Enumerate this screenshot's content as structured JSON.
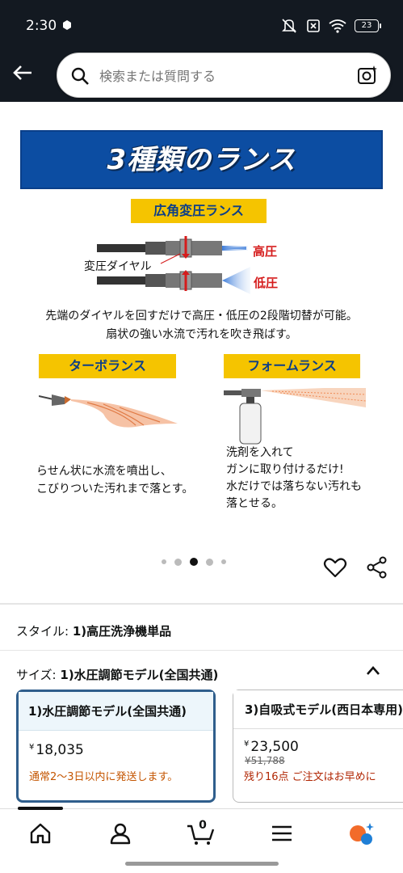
{
  "status": {
    "time": "2:30",
    "battery": "23"
  },
  "search": {
    "placeholder": "検索または質問する"
  },
  "hero": {
    "banner_title": "3種類のランス",
    "wide_lance_title": "広角変圧ランス",
    "dial_label": "変圧ダイヤル",
    "high_label": "高圧",
    "low_label": "低圧",
    "wide_desc_line1": "先端のダイヤルを回すだけで高圧・低圧の2段階切替が可能。",
    "wide_desc_line2": "扇状の強い水流で汚れを吹き飛ばす。",
    "turbo_title": "ターボランス",
    "turbo_desc_line1": "らせん状に水流を噴出し、",
    "turbo_desc_line2": "こびりついた汚れまで落とす。",
    "foam_title": "フォームランス",
    "foam_desc_line1": "洗剤を入れて",
    "foam_desc_line2": "ガンに取り付けるだけ!",
    "foam_desc_line3": "水だけでは落ちない汚れも",
    "foam_desc_line4": "落とせる。"
  },
  "carousel": {
    "total": 5,
    "active_index": 2
  },
  "style": {
    "label": "スタイル:",
    "value": "1)高圧洗浄機単品"
  },
  "size": {
    "label": "サイズ:",
    "value": "1)水圧調節モデル(全国共通)"
  },
  "variants": [
    {
      "title": "1)水圧調節モデル(全国共通)",
      "currency": "¥",
      "price": "18,035",
      "note": "通常2～3日以内に発送します。"
    },
    {
      "title": "3)自吸式モデル(西日本専用)",
      "currency": "¥",
      "price": "23,500",
      "strike": "¥51,788",
      "note": "残り16点 ご注文はお早めに"
    }
  ],
  "nav": {
    "cart_count": "0"
  },
  "colors": {
    "header": "#131921",
    "banner": "#0c4da2",
    "tag": "#f5c400",
    "selected_border": "#2f5e8c",
    "alert": "#b12704"
  }
}
